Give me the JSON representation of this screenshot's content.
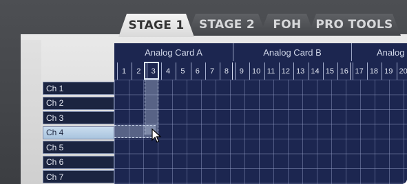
{
  "tabs": [
    {
      "label": "STAGE 1",
      "active": true
    },
    {
      "label": "STAGE 2",
      "active": false
    },
    {
      "label": "FOH",
      "active": false
    },
    {
      "label": "PRO TOOLS",
      "active": false
    }
  ],
  "cards": [
    {
      "label": "Analog Card A"
    },
    {
      "label": "Analog Card B"
    },
    {
      "label": "Analog"
    }
  ],
  "columns": [
    "1",
    "2",
    "3",
    "4",
    "5",
    "6",
    "7",
    "8",
    "9",
    "10",
    "11",
    "12",
    "13",
    "14",
    "15",
    "16",
    "17",
    "18",
    "19",
    "20"
  ],
  "rows": [
    {
      "label": "Ch 1",
      "selected": false
    },
    {
      "label": "Ch 2",
      "selected": false
    },
    {
      "label": "Ch 3",
      "selected": false
    },
    {
      "label": "Ch 4",
      "selected": true
    },
    {
      "label": "Ch 5",
      "selected": false
    },
    {
      "label": "Ch 6",
      "selected": false
    },
    {
      "label": "Ch 7",
      "selected": false
    }
  ],
  "selection": {
    "column": "3",
    "row": "Ch 4"
  },
  "colors": {
    "grid_bg": "#1c2650",
    "active_tab": "#e6e6e6",
    "inactive_tab": "#505256",
    "selected_row": "#b8d0e8"
  },
  "icons": {
    "cursor": "arrow-pointer-icon"
  }
}
